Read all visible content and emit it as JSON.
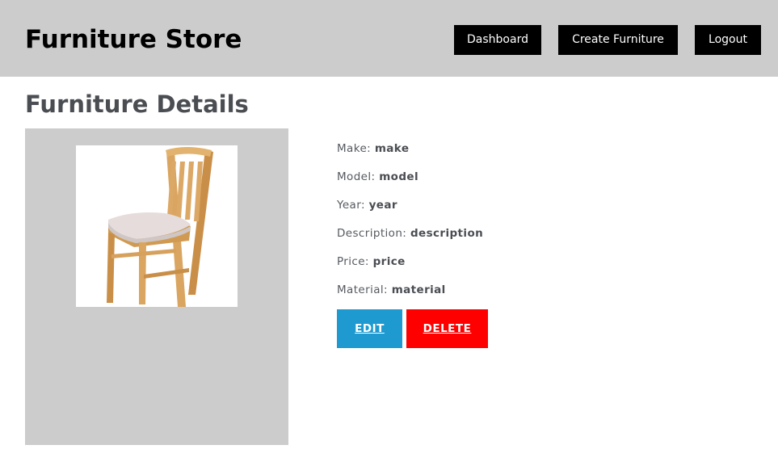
{
  "header": {
    "brand": "Furniture Store",
    "nav": {
      "dashboard": "Dashboard",
      "create": "Create Furniture",
      "logout": "Logout"
    }
  },
  "page": {
    "title": "Furniture Details"
  },
  "product_image": {
    "icon": "chair-image"
  },
  "details": [
    {
      "label": "Make:",
      "value": "make"
    },
    {
      "label": "Model:",
      "value": "model"
    },
    {
      "label": "Year:",
      "value": "year"
    },
    {
      "label": "Description:",
      "value": "description"
    },
    {
      "label": "Price:",
      "value": "price"
    },
    {
      "label": "Material:",
      "value": "material"
    }
  ],
  "actions": {
    "edit": "EDIT",
    "delete": "DELETE"
  },
  "colors": {
    "header_bg": "#cccccc",
    "edit_bg": "#1e9ad0",
    "delete_bg": "#ff0000"
  }
}
